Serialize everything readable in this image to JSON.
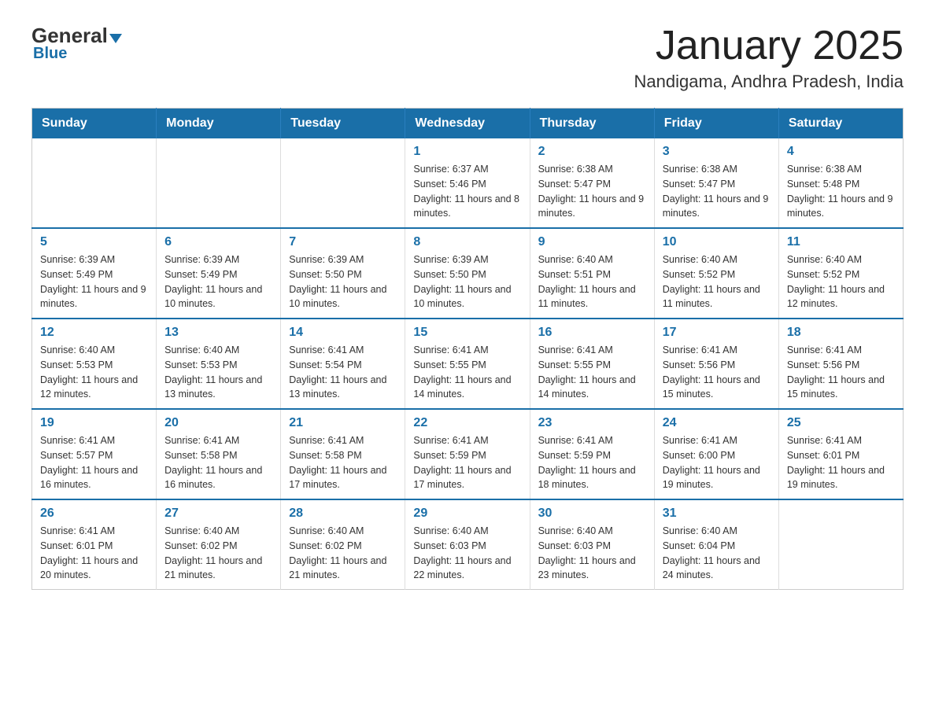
{
  "header": {
    "logo": {
      "general": "General",
      "blue": "Blue",
      "subtitle": "Blue"
    },
    "month_title": "January 2025",
    "location": "Nandigama, Andhra Pradesh, India"
  },
  "days_of_week": [
    "Sunday",
    "Monday",
    "Tuesday",
    "Wednesday",
    "Thursday",
    "Friday",
    "Saturday"
  ],
  "weeks": [
    [
      {
        "day": "",
        "info": ""
      },
      {
        "day": "",
        "info": ""
      },
      {
        "day": "",
        "info": ""
      },
      {
        "day": "1",
        "info": "Sunrise: 6:37 AM\nSunset: 5:46 PM\nDaylight: 11 hours and 8 minutes."
      },
      {
        "day": "2",
        "info": "Sunrise: 6:38 AM\nSunset: 5:47 PM\nDaylight: 11 hours and 9 minutes."
      },
      {
        "day": "3",
        "info": "Sunrise: 6:38 AM\nSunset: 5:47 PM\nDaylight: 11 hours and 9 minutes."
      },
      {
        "day": "4",
        "info": "Sunrise: 6:38 AM\nSunset: 5:48 PM\nDaylight: 11 hours and 9 minutes."
      }
    ],
    [
      {
        "day": "5",
        "info": "Sunrise: 6:39 AM\nSunset: 5:49 PM\nDaylight: 11 hours and 9 minutes."
      },
      {
        "day": "6",
        "info": "Sunrise: 6:39 AM\nSunset: 5:49 PM\nDaylight: 11 hours and 10 minutes."
      },
      {
        "day": "7",
        "info": "Sunrise: 6:39 AM\nSunset: 5:50 PM\nDaylight: 11 hours and 10 minutes."
      },
      {
        "day": "8",
        "info": "Sunrise: 6:39 AM\nSunset: 5:50 PM\nDaylight: 11 hours and 10 minutes."
      },
      {
        "day": "9",
        "info": "Sunrise: 6:40 AM\nSunset: 5:51 PM\nDaylight: 11 hours and 11 minutes."
      },
      {
        "day": "10",
        "info": "Sunrise: 6:40 AM\nSunset: 5:52 PM\nDaylight: 11 hours and 11 minutes."
      },
      {
        "day": "11",
        "info": "Sunrise: 6:40 AM\nSunset: 5:52 PM\nDaylight: 11 hours and 12 minutes."
      }
    ],
    [
      {
        "day": "12",
        "info": "Sunrise: 6:40 AM\nSunset: 5:53 PM\nDaylight: 11 hours and 12 minutes."
      },
      {
        "day": "13",
        "info": "Sunrise: 6:40 AM\nSunset: 5:53 PM\nDaylight: 11 hours and 13 minutes."
      },
      {
        "day": "14",
        "info": "Sunrise: 6:41 AM\nSunset: 5:54 PM\nDaylight: 11 hours and 13 minutes."
      },
      {
        "day": "15",
        "info": "Sunrise: 6:41 AM\nSunset: 5:55 PM\nDaylight: 11 hours and 14 minutes."
      },
      {
        "day": "16",
        "info": "Sunrise: 6:41 AM\nSunset: 5:55 PM\nDaylight: 11 hours and 14 minutes."
      },
      {
        "day": "17",
        "info": "Sunrise: 6:41 AM\nSunset: 5:56 PM\nDaylight: 11 hours and 15 minutes."
      },
      {
        "day": "18",
        "info": "Sunrise: 6:41 AM\nSunset: 5:56 PM\nDaylight: 11 hours and 15 minutes."
      }
    ],
    [
      {
        "day": "19",
        "info": "Sunrise: 6:41 AM\nSunset: 5:57 PM\nDaylight: 11 hours and 16 minutes."
      },
      {
        "day": "20",
        "info": "Sunrise: 6:41 AM\nSunset: 5:58 PM\nDaylight: 11 hours and 16 minutes."
      },
      {
        "day": "21",
        "info": "Sunrise: 6:41 AM\nSunset: 5:58 PM\nDaylight: 11 hours and 17 minutes."
      },
      {
        "day": "22",
        "info": "Sunrise: 6:41 AM\nSunset: 5:59 PM\nDaylight: 11 hours and 17 minutes."
      },
      {
        "day": "23",
        "info": "Sunrise: 6:41 AM\nSunset: 5:59 PM\nDaylight: 11 hours and 18 minutes."
      },
      {
        "day": "24",
        "info": "Sunrise: 6:41 AM\nSunset: 6:00 PM\nDaylight: 11 hours and 19 minutes."
      },
      {
        "day": "25",
        "info": "Sunrise: 6:41 AM\nSunset: 6:01 PM\nDaylight: 11 hours and 19 minutes."
      }
    ],
    [
      {
        "day": "26",
        "info": "Sunrise: 6:41 AM\nSunset: 6:01 PM\nDaylight: 11 hours and 20 minutes."
      },
      {
        "day": "27",
        "info": "Sunrise: 6:40 AM\nSunset: 6:02 PM\nDaylight: 11 hours and 21 minutes."
      },
      {
        "day": "28",
        "info": "Sunrise: 6:40 AM\nSunset: 6:02 PM\nDaylight: 11 hours and 21 minutes."
      },
      {
        "day": "29",
        "info": "Sunrise: 6:40 AM\nSunset: 6:03 PM\nDaylight: 11 hours and 22 minutes."
      },
      {
        "day": "30",
        "info": "Sunrise: 6:40 AM\nSunset: 6:03 PM\nDaylight: 11 hours and 23 minutes."
      },
      {
        "day": "31",
        "info": "Sunrise: 6:40 AM\nSunset: 6:04 PM\nDaylight: 11 hours and 24 minutes."
      },
      {
        "day": "",
        "info": ""
      }
    ]
  ]
}
